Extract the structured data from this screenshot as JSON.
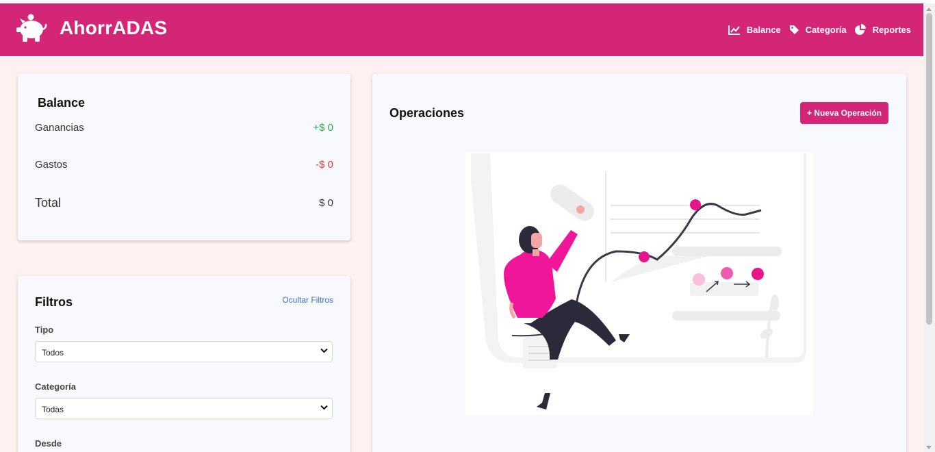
{
  "app": {
    "title": "AhorrADAS",
    "logo_icon": "piggy-bank-icon"
  },
  "nav": {
    "items": [
      {
        "label": "Balance",
        "icon": "chart-line-icon"
      },
      {
        "label": "Categoría",
        "icon": "tag-icon"
      },
      {
        "label": "Reportes",
        "icon": "pie-chart-icon"
      }
    ]
  },
  "balance": {
    "title": "Balance",
    "earnings_label": "Ganancias",
    "earnings_value": "+$ 0",
    "expenses_label": "Gastos",
    "expenses_value": "-$ 0",
    "total_label": "Total",
    "total_value": "$ 0"
  },
  "filters": {
    "title": "Filtros",
    "hide_link": "Ocultar Filtros",
    "type_label": "Tipo",
    "type_value": "Todos",
    "category_label": "Categoría",
    "category_value": "Todas",
    "from_label": "Desde"
  },
  "operations": {
    "title": "Operaciones",
    "new_button": "+ Nueva Operación",
    "illustration_icon": "empty-operations-illustration"
  },
  "colors": {
    "brand": "#d42676",
    "background": "#fff0f1",
    "positive": "#2aa54b",
    "negative": "#e53935",
    "link": "#3c6fc9"
  }
}
